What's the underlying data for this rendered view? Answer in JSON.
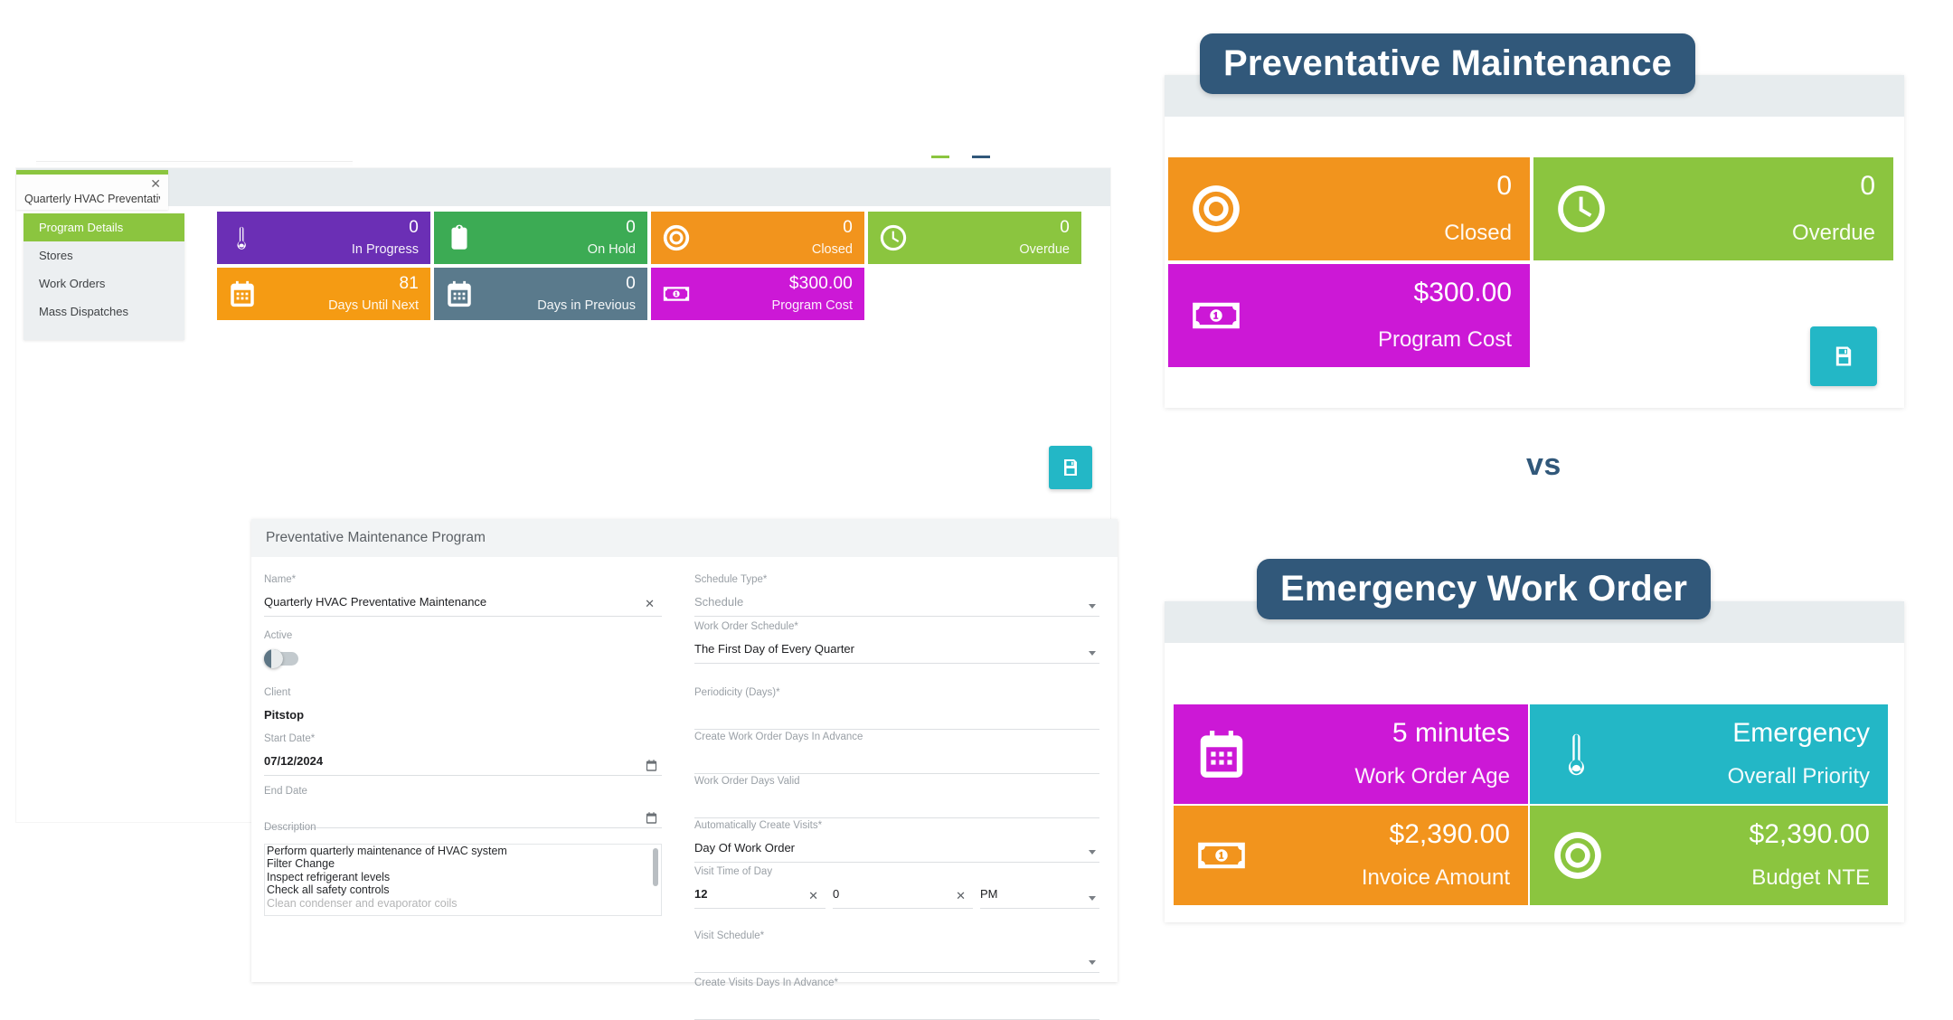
{
  "app_window": {
    "tab": {
      "label": "Quarterly HVAC Preventativ...",
      "close_icon": "close-icon"
    },
    "sidebar": {
      "items": [
        {
          "label": "Program Details",
          "active": true
        },
        {
          "label": "Stores",
          "active": false
        },
        {
          "label": "Work Orders",
          "active": false
        },
        {
          "label": "Mass Dispatches",
          "active": false
        }
      ]
    },
    "kpis": [
      {
        "value": "0",
        "label": "In Progress",
        "color": "#6b2fb5",
        "icon": "thermometer-icon"
      },
      {
        "value": "0",
        "label": "On Hold",
        "color": "#3cab54",
        "icon": "clipboard-icon"
      },
      {
        "value": "0",
        "label": "Closed",
        "color": "#f2941d",
        "icon": "target-icon"
      },
      {
        "value": "0",
        "label": "Overdue",
        "color": "#8bc53f",
        "icon": "clock-icon"
      },
      {
        "value": "81",
        "label": "Days Until Next",
        "color": "#f59b13",
        "icon": "calendar-icon"
      },
      {
        "value": "0",
        "label": "Days in Previous",
        "color": "#5a7a8c",
        "icon": "calendar-icon"
      },
      {
        "value": "$300.00",
        "label": "Program Cost",
        "color": "#cc18d6",
        "icon": "money-icon"
      }
    ],
    "save_button": {
      "label": "Save",
      "icon": "save-icon",
      "color": "#23b7c6"
    },
    "form": {
      "title": "Preventative Maintenance Program",
      "left_fields": [
        {
          "label": "Name*",
          "value": "Quarterly HVAC Preventative Maintenance",
          "type": "text-clear"
        },
        {
          "label": "Active",
          "value": "",
          "type": "toggle"
        },
        {
          "label": "Client",
          "value": "Pitstop",
          "type": "text"
        },
        {
          "label": "Start Date*",
          "value": "07/12/2024",
          "type": "date"
        },
        {
          "label": "End Date",
          "value": "",
          "type": "date"
        },
        {
          "label": "Description",
          "value": "",
          "type": "textarea"
        }
      ],
      "description_lines": [
        "Perform quarterly maintenance of HVAC system",
        "Filter Change",
        "Inspect refrigerant levels",
        "Check all safety controls",
        "Clean condenser and evaporator coils"
      ],
      "right_fields": [
        {
          "label": "Schedule Type*",
          "value": "Schedule",
          "type": "select-placeholder"
        },
        {
          "label": "Work Order Schedule*",
          "value": "The First Day of Every Quarter",
          "type": "select"
        },
        {
          "label": "Periodicity (Days)*",
          "value": "",
          "type": "text"
        },
        {
          "label": "Create Work Order Days In Advance",
          "value": "",
          "type": "text"
        },
        {
          "label": "Work Order Days Valid",
          "value": "",
          "type": "text"
        },
        {
          "label": "Automatically Create Visits*",
          "value": "Day Of Work Order",
          "type": "select"
        }
      ],
      "visit_time": {
        "label": "Visit Time of Day",
        "hour": "12",
        "minute": "0",
        "meridiem": "PM"
      },
      "trailing_fields": [
        {
          "label": "Visit Schedule*",
          "value": "",
          "type": "select"
        },
        {
          "label": "Create Visits Days In Advance*",
          "value": "",
          "type": "text"
        }
      ]
    }
  },
  "comparison": {
    "vs_label": "vs",
    "preventative": {
      "badge": "Preventative Maintenance",
      "badge_color": "#31587a",
      "kpis": [
        {
          "value": "0",
          "label": "Closed",
          "color": "#f2941d",
          "icon": "target-icon"
        },
        {
          "value": "0",
          "label": "Overdue",
          "color": "#8bc53f",
          "icon": "clock-icon"
        },
        {
          "value": "$300.00",
          "label": "Program Cost",
          "color": "#cc18d6",
          "icon": "money-icon"
        }
      ],
      "save_button": {
        "label": "Save",
        "icon": "save-icon",
        "color": "#23b7c6"
      }
    },
    "emergency": {
      "badge": "Emergency Work Order",
      "badge_color": "#31587a",
      "kpis": [
        {
          "value": "5 minutes",
          "label": "Work Order Age",
          "color": "#cc18d6",
          "icon": "calendar-icon"
        },
        {
          "value": "Emergency",
          "label": "Overall Priority",
          "color": "#23b7c6",
          "icon": "thermometer-icon"
        },
        {
          "value": "$2,390.00",
          "label": "Invoice Amount",
          "color": "#f2941d",
          "icon": "money-icon"
        },
        {
          "value": "$2,390.00",
          "label": "Budget NTE",
          "color": "#8bc53f",
          "icon": "target-icon"
        }
      ]
    }
  }
}
